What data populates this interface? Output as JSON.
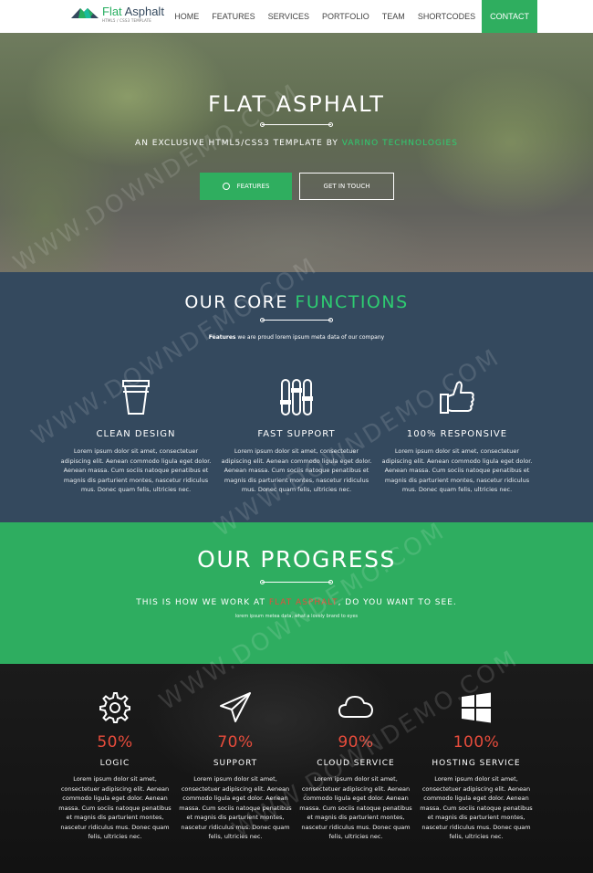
{
  "nav": {
    "logo": {
      "title_part1": "Flat",
      "title_part2": " Asphalt",
      "subtitle": "HTML5 / CSS3 TEMPLATE"
    },
    "items": [
      {
        "label": "HOME"
      },
      {
        "label": "FEATURES"
      },
      {
        "label": "SERVICES"
      },
      {
        "label": "PORTFOLIO"
      },
      {
        "label": "TEAM"
      },
      {
        "label": "SHORTCODES"
      },
      {
        "label": "CONTACT",
        "active": true
      }
    ]
  },
  "hero": {
    "title": "FLAT ASPHALT",
    "subtitle_prefix": "AN EXCLUSIVE HTML5/CSS3 TEMPLATE BY ",
    "subtitle_brand": "VARINO TECHNOLOGIES",
    "buttons": {
      "features": "FEATURES",
      "touch": "GET IN TOUCH"
    }
  },
  "core": {
    "title_part1": "OUR CORE ",
    "title_part2": "FUNCTIONS",
    "sub_bold": "Features",
    "sub_rest": " we are proud lorem ipsum meta data of our company",
    "features": [
      {
        "icon": "cup-icon",
        "title": "CLEAN DESIGN",
        "text": "Lorem ipsum dolor sit amet, consectetuer adipiscing elit. Aenean commodo ligula eget dolor. Aenean massa. Cum sociis natoque penatibus et magnis dis parturient montes, nascetur ridiculus mus. Donec quam felis, ultricies nec."
      },
      {
        "icon": "sliders-icon",
        "title": "FAST SUPPORT",
        "text": "Lorem ipsum dolor sit amet, consectetuer adipiscing elit. Aenean commodo ligula eget dolor. Aenean massa. Cum sociis natoque penatibus et magnis dis parturient montes, nascetur ridiculus mus. Donec quam felis, ultricies nec."
      },
      {
        "icon": "thumbs-up-icon",
        "title": "100% RESPONSIVE",
        "text": "Lorem ipsum dolor sit amet, consectetuer adipiscing elit. Aenean commodo ligula eget dolor. Aenean massa. Cum sociis natoque penatibus et magnis dis parturient montes, nascetur ridiculus mus. Donec quam felis, ultricies nec."
      }
    ]
  },
  "progress": {
    "title": "OUR PROGRESS",
    "sub_prefix": "THIS IS HOW WE WORK AT ",
    "sub_brand": "FLAT ASPHALT",
    "sub_suffix": ", DO YOU WANT TO SEE.",
    "small": "lorem ipsum metea data, what a lovely brand to eyes"
  },
  "stats": [
    {
      "icon": "gear-icon",
      "percent": "50%",
      "title": "LOGIC",
      "text": "Lorem ipsum dolor sit amet, consectetuer adipiscing elit. Aenean commodo ligula eget dolor. Aenean massa. Cum sociis natoque penatibus et magnis dis parturient montes, nascetur ridiculus mus. Donec quam felis, ultricies nec."
    },
    {
      "icon": "paper-plane-icon",
      "percent": "70%",
      "title": "SUPPORT",
      "text": "Lorem ipsum dolor sit amet, consectetuer adipiscing elit. Aenean commodo ligula eget dolor. Aenean massa. Cum sociis natoque penatibus et magnis dis parturient montes, nascetur ridiculus mus. Donec quam felis, ultricies nec."
    },
    {
      "icon": "cloud-icon",
      "percent": "90%",
      "title": "CLOUD SERVICE",
      "text": "Lorem ipsum dolor sit amet, consectetuer adipiscing elit. Aenean commodo ligula eget dolor. Aenean massa. Cum sociis natoque penatibus et magnis dis parturient montes, nascetur ridiculus mus. Donec quam felis, ultricies nec."
    },
    {
      "icon": "windows-icon",
      "percent": "100%",
      "title": "HOSTING SERVICE",
      "text": "Lorem ipsum dolor sit amet, consectetuer adipiscing elit. Aenean commodo ligula eget dolor. Aenean massa. Cum sociis natoque penatibus et magnis dis parturient montes, nascetur ridiculus mus. Donec quam felis, ultricies nec."
    }
  ],
  "watermark": "WWW.DOWNDEMO.COM",
  "colors": {
    "green": "#2ecc71",
    "dark_blue": "#34495e",
    "red": "#e74c3c"
  }
}
